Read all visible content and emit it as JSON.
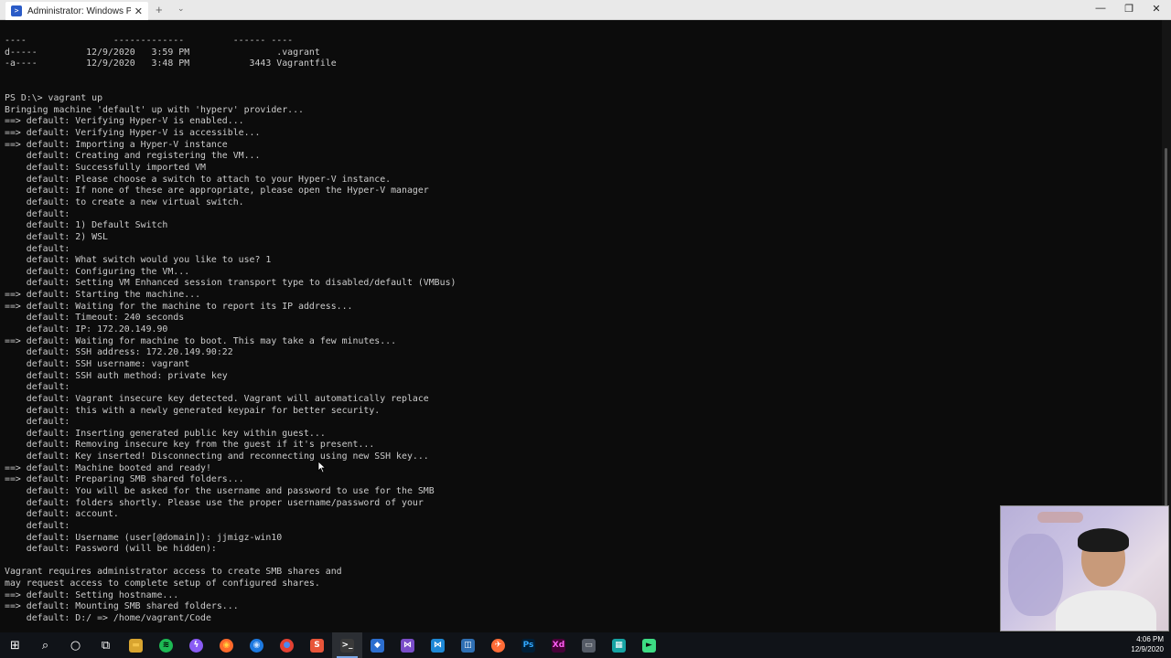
{
  "window": {
    "tab_title": "Administrator: Windows PowerS",
    "tab_close": "✕",
    "new_tab": "+",
    "tab_dropdown": "⌄",
    "minimize": "—",
    "restore": "❐",
    "close": "✕"
  },
  "terminal": {
    "lines": [
      "----                -------------         ------ ----",
      "d-----         12/9/2020   3:59 PM                .vagrant",
      "-a----         12/9/2020   3:48 PM           3443 Vagrantfile",
      "",
      "",
      "PS D:\\> vagrant up",
      "Bringing machine 'default' up with 'hyperv' provider...",
      "==> default: Verifying Hyper-V is enabled...",
      "==> default: Verifying Hyper-V is accessible...",
      "==> default: Importing a Hyper-V instance",
      "    default: Creating and registering the VM...",
      "    default: Successfully imported VM",
      "    default: Please choose a switch to attach to your Hyper-V instance.",
      "    default: If none of these are appropriate, please open the Hyper-V manager",
      "    default: to create a new virtual switch.",
      "    default:",
      "    default: 1) Default Switch",
      "    default: 2) WSL",
      "    default:",
      "    default: What switch would you like to use? 1",
      "    default: Configuring the VM...",
      "    default: Setting VM Enhanced session transport type to disabled/default (VMBus)",
      "==> default: Starting the machine...",
      "==> default: Waiting for the machine to report its IP address...",
      "    default: Timeout: 240 seconds",
      "    default: IP: 172.20.149.90",
      "==> default: Waiting for machine to boot. This may take a few minutes...",
      "    default: SSH address: 172.20.149.90:22",
      "    default: SSH username: vagrant",
      "    default: SSH auth method: private key",
      "    default:",
      "    default: Vagrant insecure key detected. Vagrant will automatically replace",
      "    default: this with a newly generated keypair for better security.",
      "    default:",
      "    default: Inserting generated public key within guest...",
      "    default: Removing insecure key from the guest if it's present...",
      "    default: Key inserted! Disconnecting and reconnecting using new SSH key...",
      "==> default: Machine booted and ready!",
      "==> default: Preparing SMB shared folders...",
      "    default: You will be asked for the username and password to use for the SMB",
      "    default: folders shortly. Please use the proper username/password of your",
      "    default: account.",
      "    default:",
      "    default: Username (user[@domain]): jjmigz-win10",
      "    default: Password (will be hidden):",
      "",
      "Vagrant requires administrator access to create SMB shares and",
      "may request access to complete setup of configured shares.",
      "==> default: Setting hostname...",
      "==> default: Mounting SMB shared folders...",
      "    default: D:/ => /home/vagrant/Code"
    ]
  },
  "taskbar": {
    "items": [
      {
        "name": "start-button",
        "icon": "windows-logo",
        "glyph": "⊞",
        "color": "#ffffff",
        "bg": "transparent"
      },
      {
        "name": "search-button",
        "icon": "search-icon",
        "glyph": "⌕",
        "color": "#ffffff",
        "bg": "transparent"
      },
      {
        "name": "cortana-button",
        "icon": "cortana-icon",
        "glyph": "○",
        "color": "#ffffff",
        "bg": "transparent"
      },
      {
        "name": "task-view-button",
        "icon": "task-view-icon",
        "glyph": "⧉",
        "color": "#ffffff",
        "bg": "transparent"
      },
      {
        "name": "file-explorer-button",
        "icon": "folder-icon",
        "glyph": "▬",
        "color": "#f3c24a",
        "bg": "#d9a530"
      },
      {
        "name": "spotify-button",
        "icon": "spotify-icon",
        "glyph": "≋",
        "color": "#000000",
        "bg": "#1db954",
        "round": true
      },
      {
        "name": "messenger-button",
        "icon": "messenger-icon",
        "glyph": "ϟ",
        "color": "#ffffff",
        "bg": "#8a5cf5",
        "round": true
      },
      {
        "name": "firefox-button",
        "icon": "firefox-icon",
        "glyph": "◉",
        "color": "#ffd23f",
        "bg": "#ff6a2b",
        "round": true
      },
      {
        "name": "firefox-dev-button",
        "icon": "firefox-developer-icon",
        "glyph": "◉",
        "color": "#c8e1ff",
        "bg": "#1d79e0",
        "round": true
      },
      {
        "name": "chrome-button",
        "icon": "chrome-icon",
        "glyph": "●",
        "color": "#4a8af4",
        "bg": "#e34133",
        "round": true
      },
      {
        "name": "sublime-button",
        "icon": "sublime-text-icon",
        "glyph": "S",
        "color": "#ffffff",
        "bg": "#e8553a"
      },
      {
        "name": "terminal-button",
        "icon": "terminal-icon",
        "glyph": ">_",
        "color": "#ffffff",
        "bg": "#3a3a3a",
        "active": true
      },
      {
        "name": "sourcetree-button",
        "icon": "git-client-icon",
        "glyph": "◆",
        "color": "#ffffff",
        "bg": "#2c6ecf"
      },
      {
        "name": "visual-studio-button",
        "icon": "visual-studio-icon",
        "glyph": "⋈",
        "color": "#ffffff",
        "bg": "#7a4dc8"
      },
      {
        "name": "vscode-button",
        "icon": "vscode-icon",
        "glyph": "⋈",
        "color": "#ffffff",
        "bg": "#1e88d6"
      },
      {
        "name": "app-button-1",
        "icon": "app-icon",
        "glyph": "◫",
        "color": "#ffffff",
        "bg": "#2f6fb3"
      },
      {
        "name": "postman-button",
        "icon": "postman-icon",
        "glyph": "✈",
        "color": "#ffffff",
        "bg": "#ff6c37",
        "round": true
      },
      {
        "name": "photoshop-button",
        "icon": "photoshop-icon",
        "glyph": "Ps",
        "color": "#31a8ff",
        "bg": "#001e36"
      },
      {
        "name": "adobe-xd-button",
        "icon": "adobe-xd-icon",
        "glyph": "Xd",
        "color": "#ff61f6",
        "bg": "#470137"
      },
      {
        "name": "app-button-2",
        "icon": "app-icon",
        "glyph": "▭",
        "color": "#dddddd",
        "bg": "#555b66"
      },
      {
        "name": "app-button-3",
        "icon": "app-icon",
        "glyph": "▦",
        "color": "#ffffff",
        "bg": "#16a3a3"
      },
      {
        "name": "app-button-4",
        "icon": "app-icon",
        "glyph": "►",
        "color": "#0c0c0c",
        "bg": "#3ddc84"
      }
    ],
    "clock": {
      "time": "4:06 PM",
      "date": "12/9/2020"
    }
  }
}
